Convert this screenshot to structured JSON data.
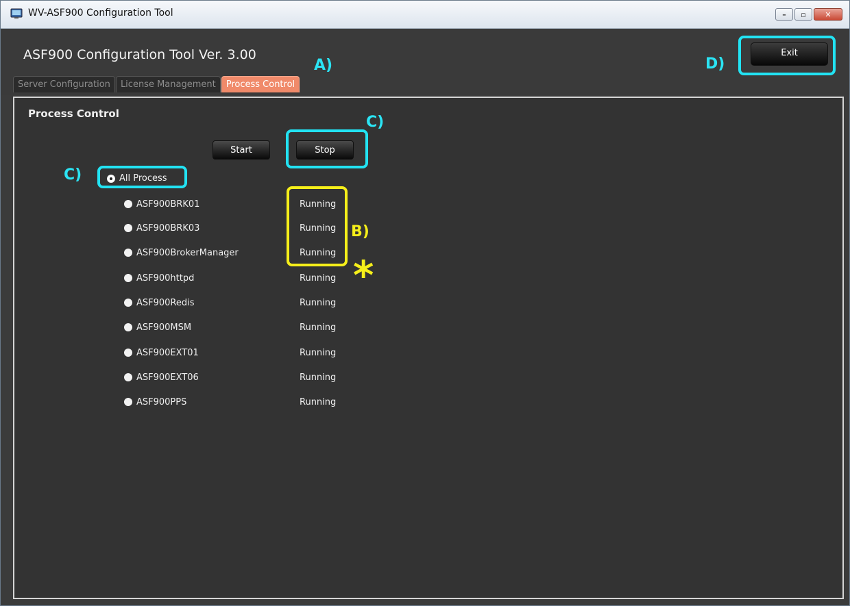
{
  "window": {
    "title": "WV-ASF900 Configuration Tool"
  },
  "header": {
    "app_title": "ASF900 Configuration Tool  Ver. 3.00",
    "exit_label": "Exit",
    "tabs": [
      {
        "label": "Server Configuration",
        "active": false
      },
      {
        "label": "License Management",
        "active": false
      },
      {
        "label": "Process Control",
        "active": true
      }
    ]
  },
  "content": {
    "section_title": "Process Control",
    "start_label": "Start",
    "stop_label": "Stop",
    "all_process_label": "All Process",
    "processes": [
      {
        "name": "ASF900BRK01",
        "status": "Running"
      },
      {
        "name": "ASF900BRK03",
        "status": "Running"
      },
      {
        "name": "ASF900BrokerManager",
        "status": "Running"
      },
      {
        "name": "ASF900httpd",
        "status": "Running"
      },
      {
        "name": "ASF900Redis",
        "status": "Running"
      },
      {
        "name": "ASF900MSM",
        "status": "Running"
      },
      {
        "name": "ASF900EXT01",
        "status": "Running"
      },
      {
        "name": "ASF900EXT06",
        "status": "Running"
      },
      {
        "name": "ASF900PPS",
        "status": "Running"
      }
    ]
  },
  "annotations": {
    "a": "A)",
    "b": "B)",
    "c": "C)",
    "c2": "C)",
    "d": "D)",
    "star": "*"
  },
  "colors": {
    "annotation_cyan": "#22e3f3",
    "annotation_yellow": "#f6ef1a",
    "active_tab": "#f08a6a"
  }
}
